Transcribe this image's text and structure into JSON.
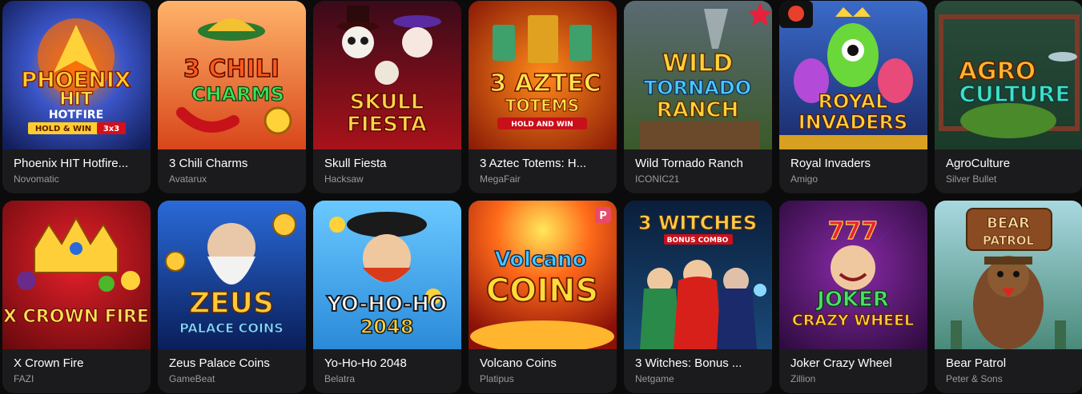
{
  "games": [
    {
      "title": "Phoenix HIT Hotfire...",
      "provider": "Novomatic",
      "art": [
        "PHOENIX",
        "HIT",
        "HOTFIRE",
        "HOLD & WIN",
        "3x3"
      ],
      "colors": {
        "bg": "#1f3fa8",
        "accent": "#ffb400"
      }
    },
    {
      "title": "3 Chili Charms",
      "provider": "Avatarux",
      "art": [
        "3 CHILI",
        "CHARMS"
      ],
      "colors": {
        "bg": "#e8692a",
        "accent": "#2ec44f"
      }
    },
    {
      "title": "Skull Fiesta",
      "provider": "Hacksaw",
      "art": [
        "SKULL",
        "FIESTA"
      ],
      "colors": {
        "bg": "#7a1018",
        "accent": "#ffcf3a"
      }
    },
    {
      "title": "3 Aztec Totems: H...",
      "provider": "MegaFair",
      "art": [
        "3 AZTEC",
        "TOTEMS",
        "HOLD AND WIN"
      ],
      "colors": {
        "bg": "#c9420f",
        "accent": "#ffe34d"
      }
    },
    {
      "title": "Wild Tornado Ranch",
      "provider": "ICONIC21",
      "art": [
        "WILD",
        "TORNADO",
        "RANCH"
      ],
      "colors": {
        "bg": "#4c6a4a",
        "accent": "#ffd23a"
      }
    },
    {
      "title": "Royal Invaders",
      "provider": "Amigo",
      "art": [
        "ROYAL",
        "INVADERS"
      ],
      "colors": {
        "bg": "#2a4c9c",
        "accent": "#ffd23a"
      }
    },
    {
      "title": "AgroCulture",
      "provider": "Silver Bullet",
      "art": [
        "AGRO",
        "CULTURE"
      ],
      "colors": {
        "bg": "#1f5a4a",
        "accent": "#ffb52e"
      }
    },
    {
      "title": "X Crown Fire",
      "provider": "FAZI",
      "art": [
        "X CROWN FIRE"
      ],
      "colors": {
        "bg": "#b3121a",
        "accent": "#ffd54a"
      }
    },
    {
      "title": "Zeus Palace Coins",
      "provider": "GameBeat",
      "art": [
        "ZEUS",
        "PALACE COINS"
      ],
      "colors": {
        "bg": "#1d4fa3",
        "accent": "#ffc93a"
      }
    },
    {
      "title": "Yo-Ho-Ho 2048",
      "provider": "Belatra",
      "art": [
        "YO-HO-HO",
        "2048"
      ],
      "colors": {
        "bg": "#3aa6e8",
        "accent": "#ffd23a"
      }
    },
    {
      "title": "Volcano Coins",
      "provider": "Platipus",
      "art": [
        "Volcano",
        "COINS"
      ],
      "colors": {
        "bg": "#e0421a",
        "accent": "#ffdb3a"
      }
    },
    {
      "title": "3 Witches: Bonus ...",
      "provider": "Netgame",
      "art": [
        "3 WITCHES",
        "BONUS COMBO"
      ],
      "colors": {
        "bg": "#123a6a",
        "accent": "#ffcc4a"
      }
    },
    {
      "title": "Joker Crazy Wheel",
      "provider": "Zillion",
      "art": [
        "777",
        "JOKER",
        "CRAZY WHEEL"
      ],
      "colors": {
        "bg": "#5a1a7a",
        "accent": "#ffd23a"
      }
    },
    {
      "title": "Bear Patrol",
      "provider": "Peter & Sons",
      "art": [
        "BEAR",
        "PATROL"
      ],
      "colors": {
        "bg": "#6aa8b8",
        "accent": "#8a4a22"
      }
    }
  ]
}
